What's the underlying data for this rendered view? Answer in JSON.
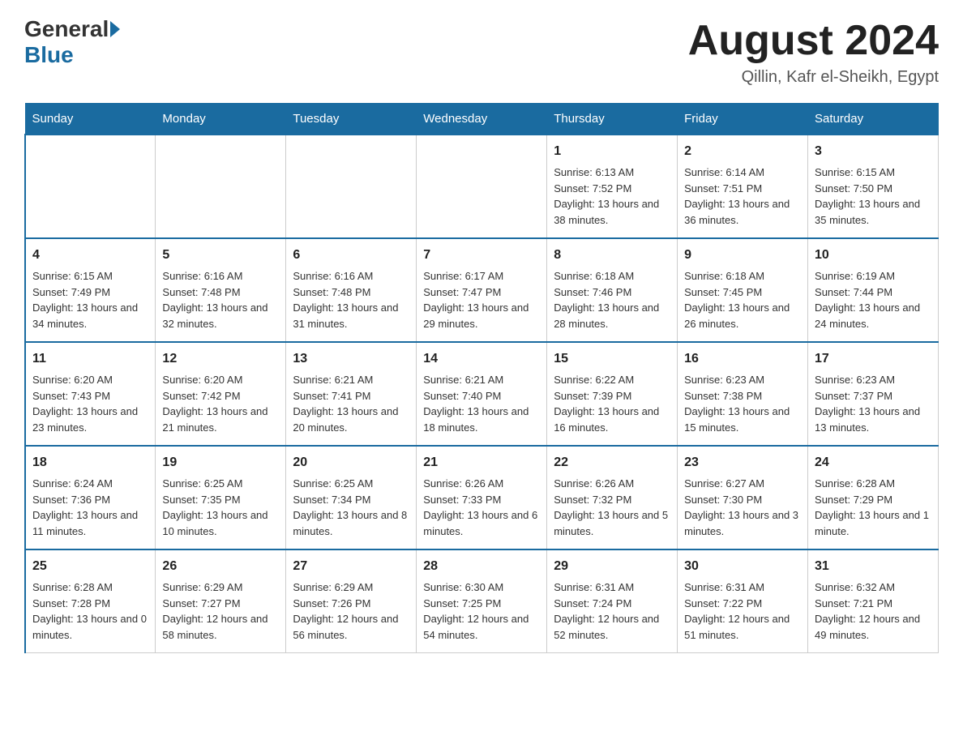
{
  "header": {
    "logo_general": "General",
    "logo_blue": "Blue",
    "month_title": "August 2024",
    "location": "Qillin, Kafr el-Sheikh, Egypt"
  },
  "days_of_week": [
    "Sunday",
    "Monday",
    "Tuesday",
    "Wednesday",
    "Thursday",
    "Friday",
    "Saturday"
  ],
  "weeks": [
    [
      {
        "day": "",
        "sunrise": "",
        "sunset": "",
        "daylight": ""
      },
      {
        "day": "",
        "sunrise": "",
        "sunset": "",
        "daylight": ""
      },
      {
        "day": "",
        "sunrise": "",
        "sunset": "",
        "daylight": ""
      },
      {
        "day": "",
        "sunrise": "",
        "sunset": "",
        "daylight": ""
      },
      {
        "day": "1",
        "sunrise": "Sunrise: 6:13 AM",
        "sunset": "Sunset: 7:52 PM",
        "daylight": "Daylight: 13 hours and 38 minutes."
      },
      {
        "day": "2",
        "sunrise": "Sunrise: 6:14 AM",
        "sunset": "Sunset: 7:51 PM",
        "daylight": "Daylight: 13 hours and 36 minutes."
      },
      {
        "day": "3",
        "sunrise": "Sunrise: 6:15 AM",
        "sunset": "Sunset: 7:50 PM",
        "daylight": "Daylight: 13 hours and 35 minutes."
      }
    ],
    [
      {
        "day": "4",
        "sunrise": "Sunrise: 6:15 AM",
        "sunset": "Sunset: 7:49 PM",
        "daylight": "Daylight: 13 hours and 34 minutes."
      },
      {
        "day": "5",
        "sunrise": "Sunrise: 6:16 AM",
        "sunset": "Sunset: 7:48 PM",
        "daylight": "Daylight: 13 hours and 32 minutes."
      },
      {
        "day": "6",
        "sunrise": "Sunrise: 6:16 AM",
        "sunset": "Sunset: 7:48 PM",
        "daylight": "Daylight: 13 hours and 31 minutes."
      },
      {
        "day": "7",
        "sunrise": "Sunrise: 6:17 AM",
        "sunset": "Sunset: 7:47 PM",
        "daylight": "Daylight: 13 hours and 29 minutes."
      },
      {
        "day": "8",
        "sunrise": "Sunrise: 6:18 AM",
        "sunset": "Sunset: 7:46 PM",
        "daylight": "Daylight: 13 hours and 28 minutes."
      },
      {
        "day": "9",
        "sunrise": "Sunrise: 6:18 AM",
        "sunset": "Sunset: 7:45 PM",
        "daylight": "Daylight: 13 hours and 26 minutes."
      },
      {
        "day": "10",
        "sunrise": "Sunrise: 6:19 AM",
        "sunset": "Sunset: 7:44 PM",
        "daylight": "Daylight: 13 hours and 24 minutes."
      }
    ],
    [
      {
        "day": "11",
        "sunrise": "Sunrise: 6:20 AM",
        "sunset": "Sunset: 7:43 PM",
        "daylight": "Daylight: 13 hours and 23 minutes."
      },
      {
        "day": "12",
        "sunrise": "Sunrise: 6:20 AM",
        "sunset": "Sunset: 7:42 PM",
        "daylight": "Daylight: 13 hours and 21 minutes."
      },
      {
        "day": "13",
        "sunrise": "Sunrise: 6:21 AM",
        "sunset": "Sunset: 7:41 PM",
        "daylight": "Daylight: 13 hours and 20 minutes."
      },
      {
        "day": "14",
        "sunrise": "Sunrise: 6:21 AM",
        "sunset": "Sunset: 7:40 PM",
        "daylight": "Daylight: 13 hours and 18 minutes."
      },
      {
        "day": "15",
        "sunrise": "Sunrise: 6:22 AM",
        "sunset": "Sunset: 7:39 PM",
        "daylight": "Daylight: 13 hours and 16 minutes."
      },
      {
        "day": "16",
        "sunrise": "Sunrise: 6:23 AM",
        "sunset": "Sunset: 7:38 PM",
        "daylight": "Daylight: 13 hours and 15 minutes."
      },
      {
        "day": "17",
        "sunrise": "Sunrise: 6:23 AM",
        "sunset": "Sunset: 7:37 PM",
        "daylight": "Daylight: 13 hours and 13 minutes."
      }
    ],
    [
      {
        "day": "18",
        "sunrise": "Sunrise: 6:24 AM",
        "sunset": "Sunset: 7:36 PM",
        "daylight": "Daylight: 13 hours and 11 minutes."
      },
      {
        "day": "19",
        "sunrise": "Sunrise: 6:25 AM",
        "sunset": "Sunset: 7:35 PM",
        "daylight": "Daylight: 13 hours and 10 minutes."
      },
      {
        "day": "20",
        "sunrise": "Sunrise: 6:25 AM",
        "sunset": "Sunset: 7:34 PM",
        "daylight": "Daylight: 13 hours and 8 minutes."
      },
      {
        "day": "21",
        "sunrise": "Sunrise: 6:26 AM",
        "sunset": "Sunset: 7:33 PM",
        "daylight": "Daylight: 13 hours and 6 minutes."
      },
      {
        "day": "22",
        "sunrise": "Sunrise: 6:26 AM",
        "sunset": "Sunset: 7:32 PM",
        "daylight": "Daylight: 13 hours and 5 minutes."
      },
      {
        "day": "23",
        "sunrise": "Sunrise: 6:27 AM",
        "sunset": "Sunset: 7:30 PM",
        "daylight": "Daylight: 13 hours and 3 minutes."
      },
      {
        "day": "24",
        "sunrise": "Sunrise: 6:28 AM",
        "sunset": "Sunset: 7:29 PM",
        "daylight": "Daylight: 13 hours and 1 minute."
      }
    ],
    [
      {
        "day": "25",
        "sunrise": "Sunrise: 6:28 AM",
        "sunset": "Sunset: 7:28 PM",
        "daylight": "Daylight: 13 hours and 0 minutes."
      },
      {
        "day": "26",
        "sunrise": "Sunrise: 6:29 AM",
        "sunset": "Sunset: 7:27 PM",
        "daylight": "Daylight: 12 hours and 58 minutes."
      },
      {
        "day": "27",
        "sunrise": "Sunrise: 6:29 AM",
        "sunset": "Sunset: 7:26 PM",
        "daylight": "Daylight: 12 hours and 56 minutes."
      },
      {
        "day": "28",
        "sunrise": "Sunrise: 6:30 AM",
        "sunset": "Sunset: 7:25 PM",
        "daylight": "Daylight: 12 hours and 54 minutes."
      },
      {
        "day": "29",
        "sunrise": "Sunrise: 6:31 AM",
        "sunset": "Sunset: 7:24 PM",
        "daylight": "Daylight: 12 hours and 52 minutes."
      },
      {
        "day": "30",
        "sunrise": "Sunrise: 6:31 AM",
        "sunset": "Sunset: 7:22 PM",
        "daylight": "Daylight: 12 hours and 51 minutes."
      },
      {
        "day": "31",
        "sunrise": "Sunrise: 6:32 AM",
        "sunset": "Sunset: 7:21 PM",
        "daylight": "Daylight: 12 hours and 49 minutes."
      }
    ]
  ]
}
